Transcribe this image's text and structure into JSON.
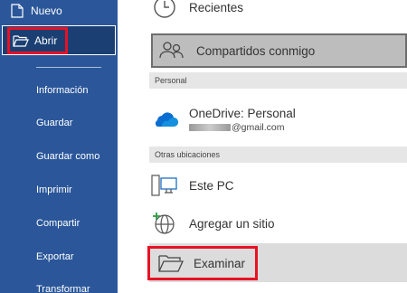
{
  "sidebar": {
    "nuevo": "Nuevo",
    "abrir": "Abrir",
    "items": [
      "Información",
      "Guardar",
      "Guardar como",
      "Imprimir",
      "Compartir",
      "Exportar",
      "Transformar"
    ]
  },
  "main": {
    "recientes": "Recientes",
    "compartidos": "Compartidos conmigo",
    "personal_header": "Personal",
    "onedrive_title": "OneDrive: Personal",
    "onedrive_email_suffix": "@gmail.com",
    "otras_header": "Otras ubicaciones",
    "este_pc": "Este PC",
    "agregar_sitio": "Agregar un sitio",
    "examinar": "Examinar"
  },
  "colors": {
    "sidebar": "#2b579a",
    "highlight": "#e81123",
    "onedrive": "#0a6ed1"
  }
}
